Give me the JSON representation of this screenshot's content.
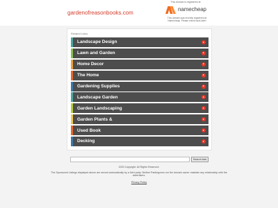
{
  "header": {
    "domain": "gardenofreasonbooks.com",
    "registered_text": "This domain is registered at",
    "registrar_name": "namecheap",
    "registrar_note": "This domain was recently registered at Namecheap. Please check back later!"
  },
  "related": {
    "title": "Related Links",
    "items": [
      {
        "label": "Landscape Design",
        "accent": "#4aa8a0"
      },
      {
        "label": "Lawn and Garden",
        "accent": "#8cc152"
      },
      {
        "label": "Home Decor",
        "accent": "#f0a03c"
      },
      {
        "label": "The Home",
        "accent": "#e9692c"
      },
      {
        "label": "Gardening Supplies",
        "accent": "#3e7aa9"
      },
      {
        "label": "Landscape Garden",
        "accent": "#4aa8a0"
      },
      {
        "label": "Garden Landscaping",
        "accent": "#b5cf34"
      },
      {
        "label": "Garden Plants &",
        "accent": "#f2c94c"
      },
      {
        "label": "Used Book",
        "accent": "#e9692c"
      },
      {
        "label": "Decking",
        "accent": "#3e7aa9"
      }
    ]
  },
  "search": {
    "placeholder": "",
    "button_label": "Search Ads"
  },
  "footer": {
    "copyright": "2020 Copyright. All Rights Reserved.",
    "disclaimer": "The Sponsored Listings displayed above are served automatically by a third party. Neither Parkingcrew nor the domain owner maintain any relationship with the advertisers.",
    "privacy": "Privacy Policy"
  },
  "colors": {
    "domain": "#d2402f",
    "row_background": "#4d4d4d",
    "arrow": "#e2382d",
    "namecheap_orange": "#f26b21"
  }
}
